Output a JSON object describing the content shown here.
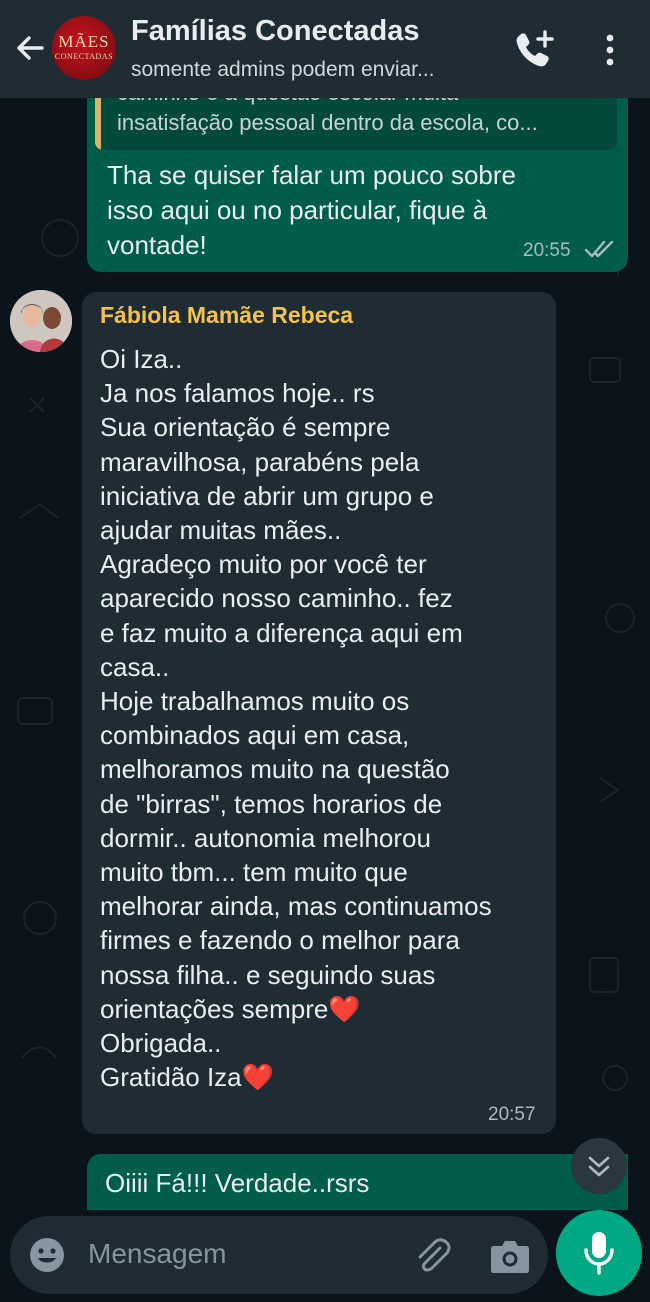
{
  "header": {
    "back_icon": "arrow-left-icon",
    "group_logo_top": "MÃES",
    "group_logo_bottom": "CONECTADAS",
    "title": "Famílias Conectadas",
    "subtitle": "somente admins podem enviar...",
    "call_icon": "add-call-icon",
    "menu_icon": "kebab-menu-icon"
  },
  "messages": {
    "out1": {
      "quote_line1": "caminho e a questão escolar muita",
      "quote_line2": "insatisfação pessoal dentro da escola, co...",
      "text": "Tha se quiser falar um pouco sobre\nisso aqui ou no particular, fique à\nvontade!",
      "time": "20:55",
      "status": "read"
    },
    "in1": {
      "sender": "Fábiola Mamãe Rebeca",
      "text": "Oi Iza..\nJa nos falamos hoje.. rs\nSua orientação é sempre\nmaravilhosa, parabéns pela\niniciativa de abrir um grupo e\najudar muitas mães..\nAgradeço muito por você ter\naparecido nosso caminho..  fez\ne faz muito a diferença aqui em\ncasa..\nHoje trabalhamos muito os\ncombinados aqui em casa,\nmelhoramos muito na questão\nde \"birras\", temos horarios de\ndormir.. autonomia melhorou\nmuito tbm... tem muito que\nmelhorar ainda, mas continuamos\nfirmes e fazendo o melhor  para\nnossa filha.. e seguindo suas\norientações sempre❤️\nObrigada..\nGratidão Iza❤️",
      "time": "20:57"
    },
    "out2": {
      "text": "Oiiii Fá!!! Verdade..rsrs"
    }
  },
  "input": {
    "placeholder": "Mensagem",
    "emoji_icon": "emoji-icon",
    "attach_icon": "paperclip-icon",
    "camera_icon": "camera-icon",
    "mic_icon": "microphone-icon"
  },
  "colors": {
    "header_bg": "#1f2c34",
    "chat_bg": "#0b141a",
    "outgoing_bubble": "#005c4b",
    "incoming_bubble": "#1f2c34",
    "sender_name": "#f2c24f",
    "accent": "#00a884"
  }
}
